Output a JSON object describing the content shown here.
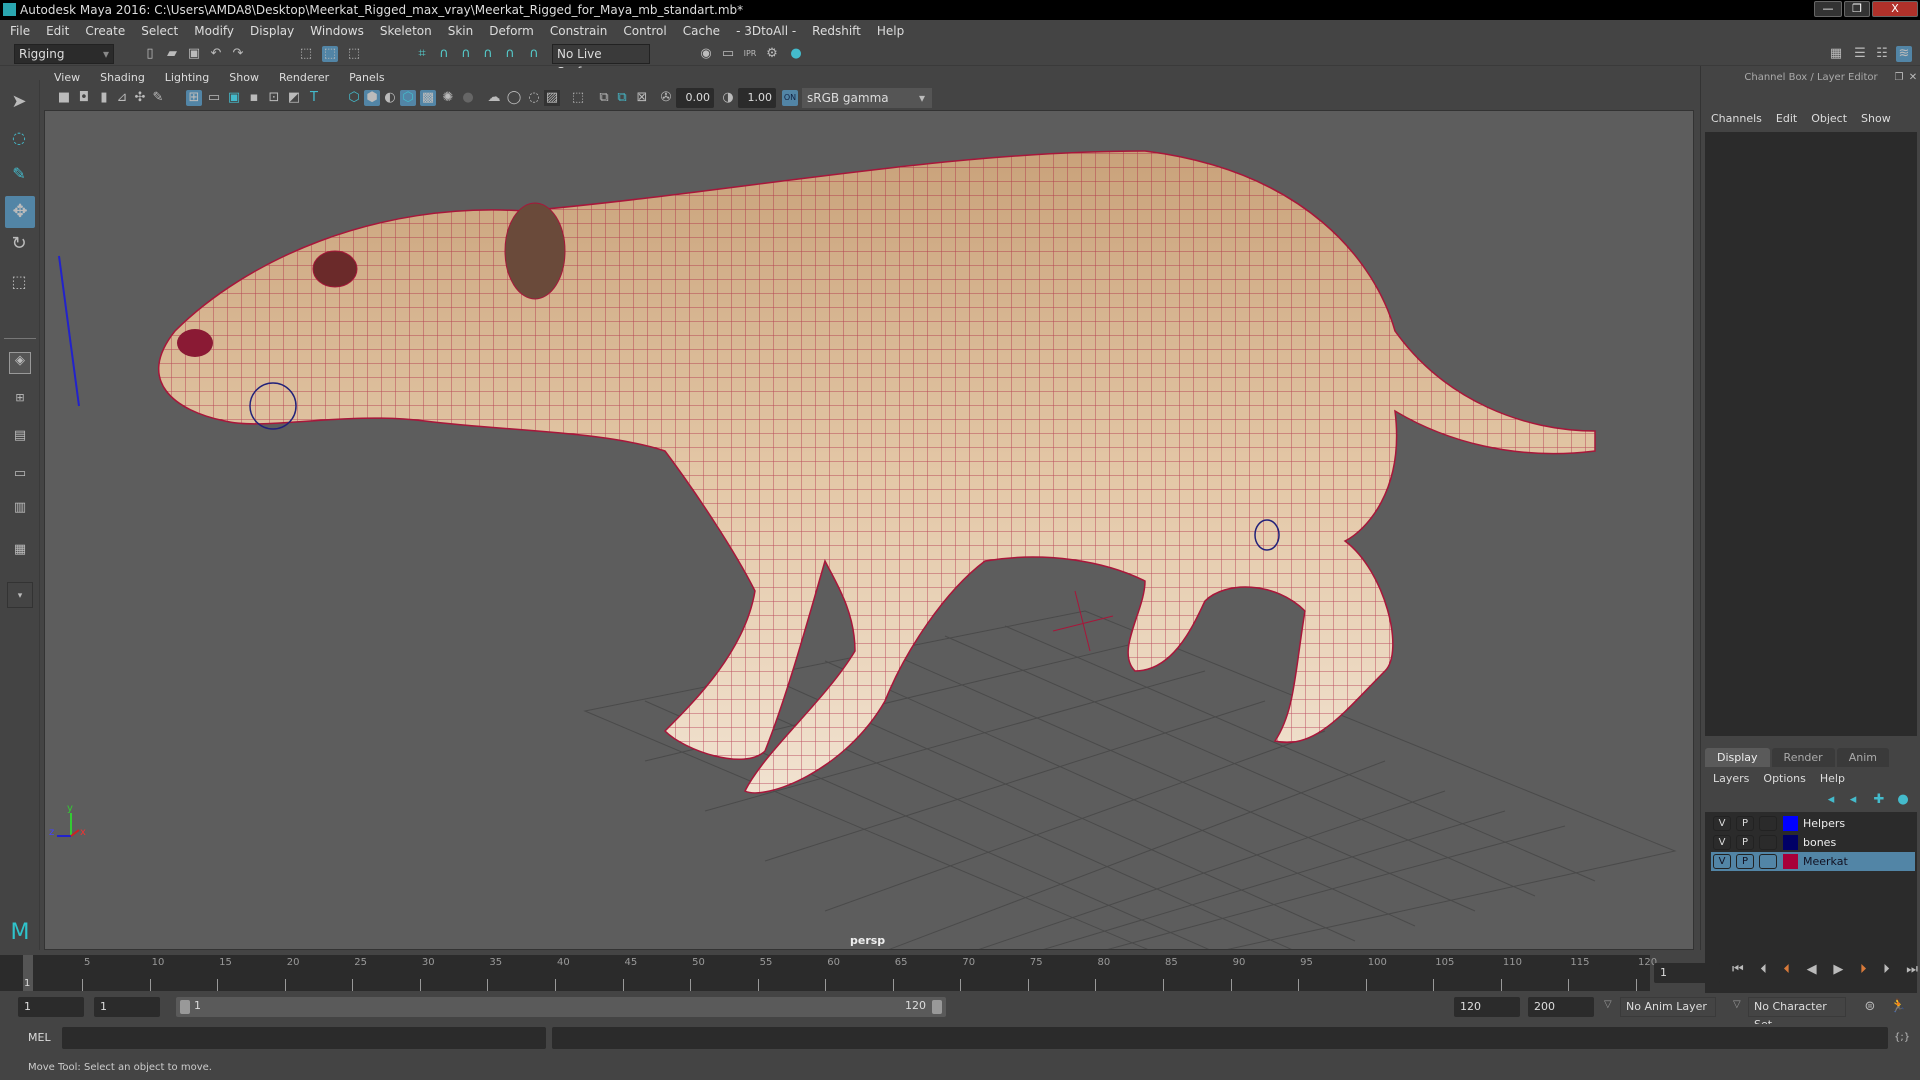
{
  "window": {
    "title": "Autodesk Maya 2016: C:\\Users\\AMDA8\\Desktop\\Meerkat_Rigged_max_vray\\Meerkat_Rigged_for_Maya_mb_standart.mb*",
    "minimize": "—",
    "restore": "❐",
    "close": "X"
  },
  "menubar": [
    "File",
    "Edit",
    "Create",
    "Select",
    "Modify",
    "Display",
    "Windows",
    "Skeleton",
    "Skin",
    "Deform",
    "Constrain",
    "Control",
    "Cache",
    "- 3DtoAll -",
    "Redshift",
    "Help"
  ],
  "shelf": {
    "menuset": "Rigging",
    "live_surface": "No Live Surface"
  },
  "viewport": {
    "menus": [
      "View",
      "Shading",
      "Lighting",
      "Show",
      "Renderer",
      "Panels"
    ],
    "exposure": "0.00",
    "gamma": "1.00",
    "color_mgmt": "sRGB gamma",
    "camera_label": "persp",
    "axis": {
      "x": "x",
      "y": "y",
      "z": "z"
    },
    "mesh_color": "#a8163a",
    "background": "#5d5d5d"
  },
  "rightpanel": {
    "title": "Channel Box / Layer Editor",
    "cb_menus": [
      "Channels",
      "Edit",
      "Object",
      "Show"
    ],
    "tabs": [
      "Display",
      "Render",
      "Anim"
    ],
    "layer_menus": [
      "Layers",
      "Options",
      "Help"
    ],
    "layers": [
      {
        "v": "V",
        "p": "P",
        "color": "#0000ff",
        "name": "Helpers",
        "selected": false
      },
      {
        "v": "V",
        "p": "P",
        "color": "#000066",
        "name": "bones",
        "selected": false
      },
      {
        "v": "V",
        "p": "P",
        "color": "#a8003a",
        "name": "Meerkat",
        "selected": true
      }
    ]
  },
  "timeline": {
    "ticks": [
      "5",
      "10",
      "15",
      "20",
      "25",
      "30",
      "35",
      "40",
      "45",
      "50",
      "55",
      "60",
      "65",
      "70",
      "75",
      "80",
      "85",
      "90",
      "95",
      "100",
      "105",
      "110",
      "115",
      "120"
    ],
    "current_frame_marker": "1",
    "current_frame": "1"
  },
  "range": {
    "start": "1",
    "anim_start": "1",
    "slider_start": "1",
    "slider_end": "120",
    "end": "120",
    "anim_end": "200",
    "anim_layer": "No Anim Layer",
    "character_set": "No Character Set"
  },
  "mel": {
    "label": "MEL"
  },
  "help_line": "Move Tool: Select an object to move."
}
